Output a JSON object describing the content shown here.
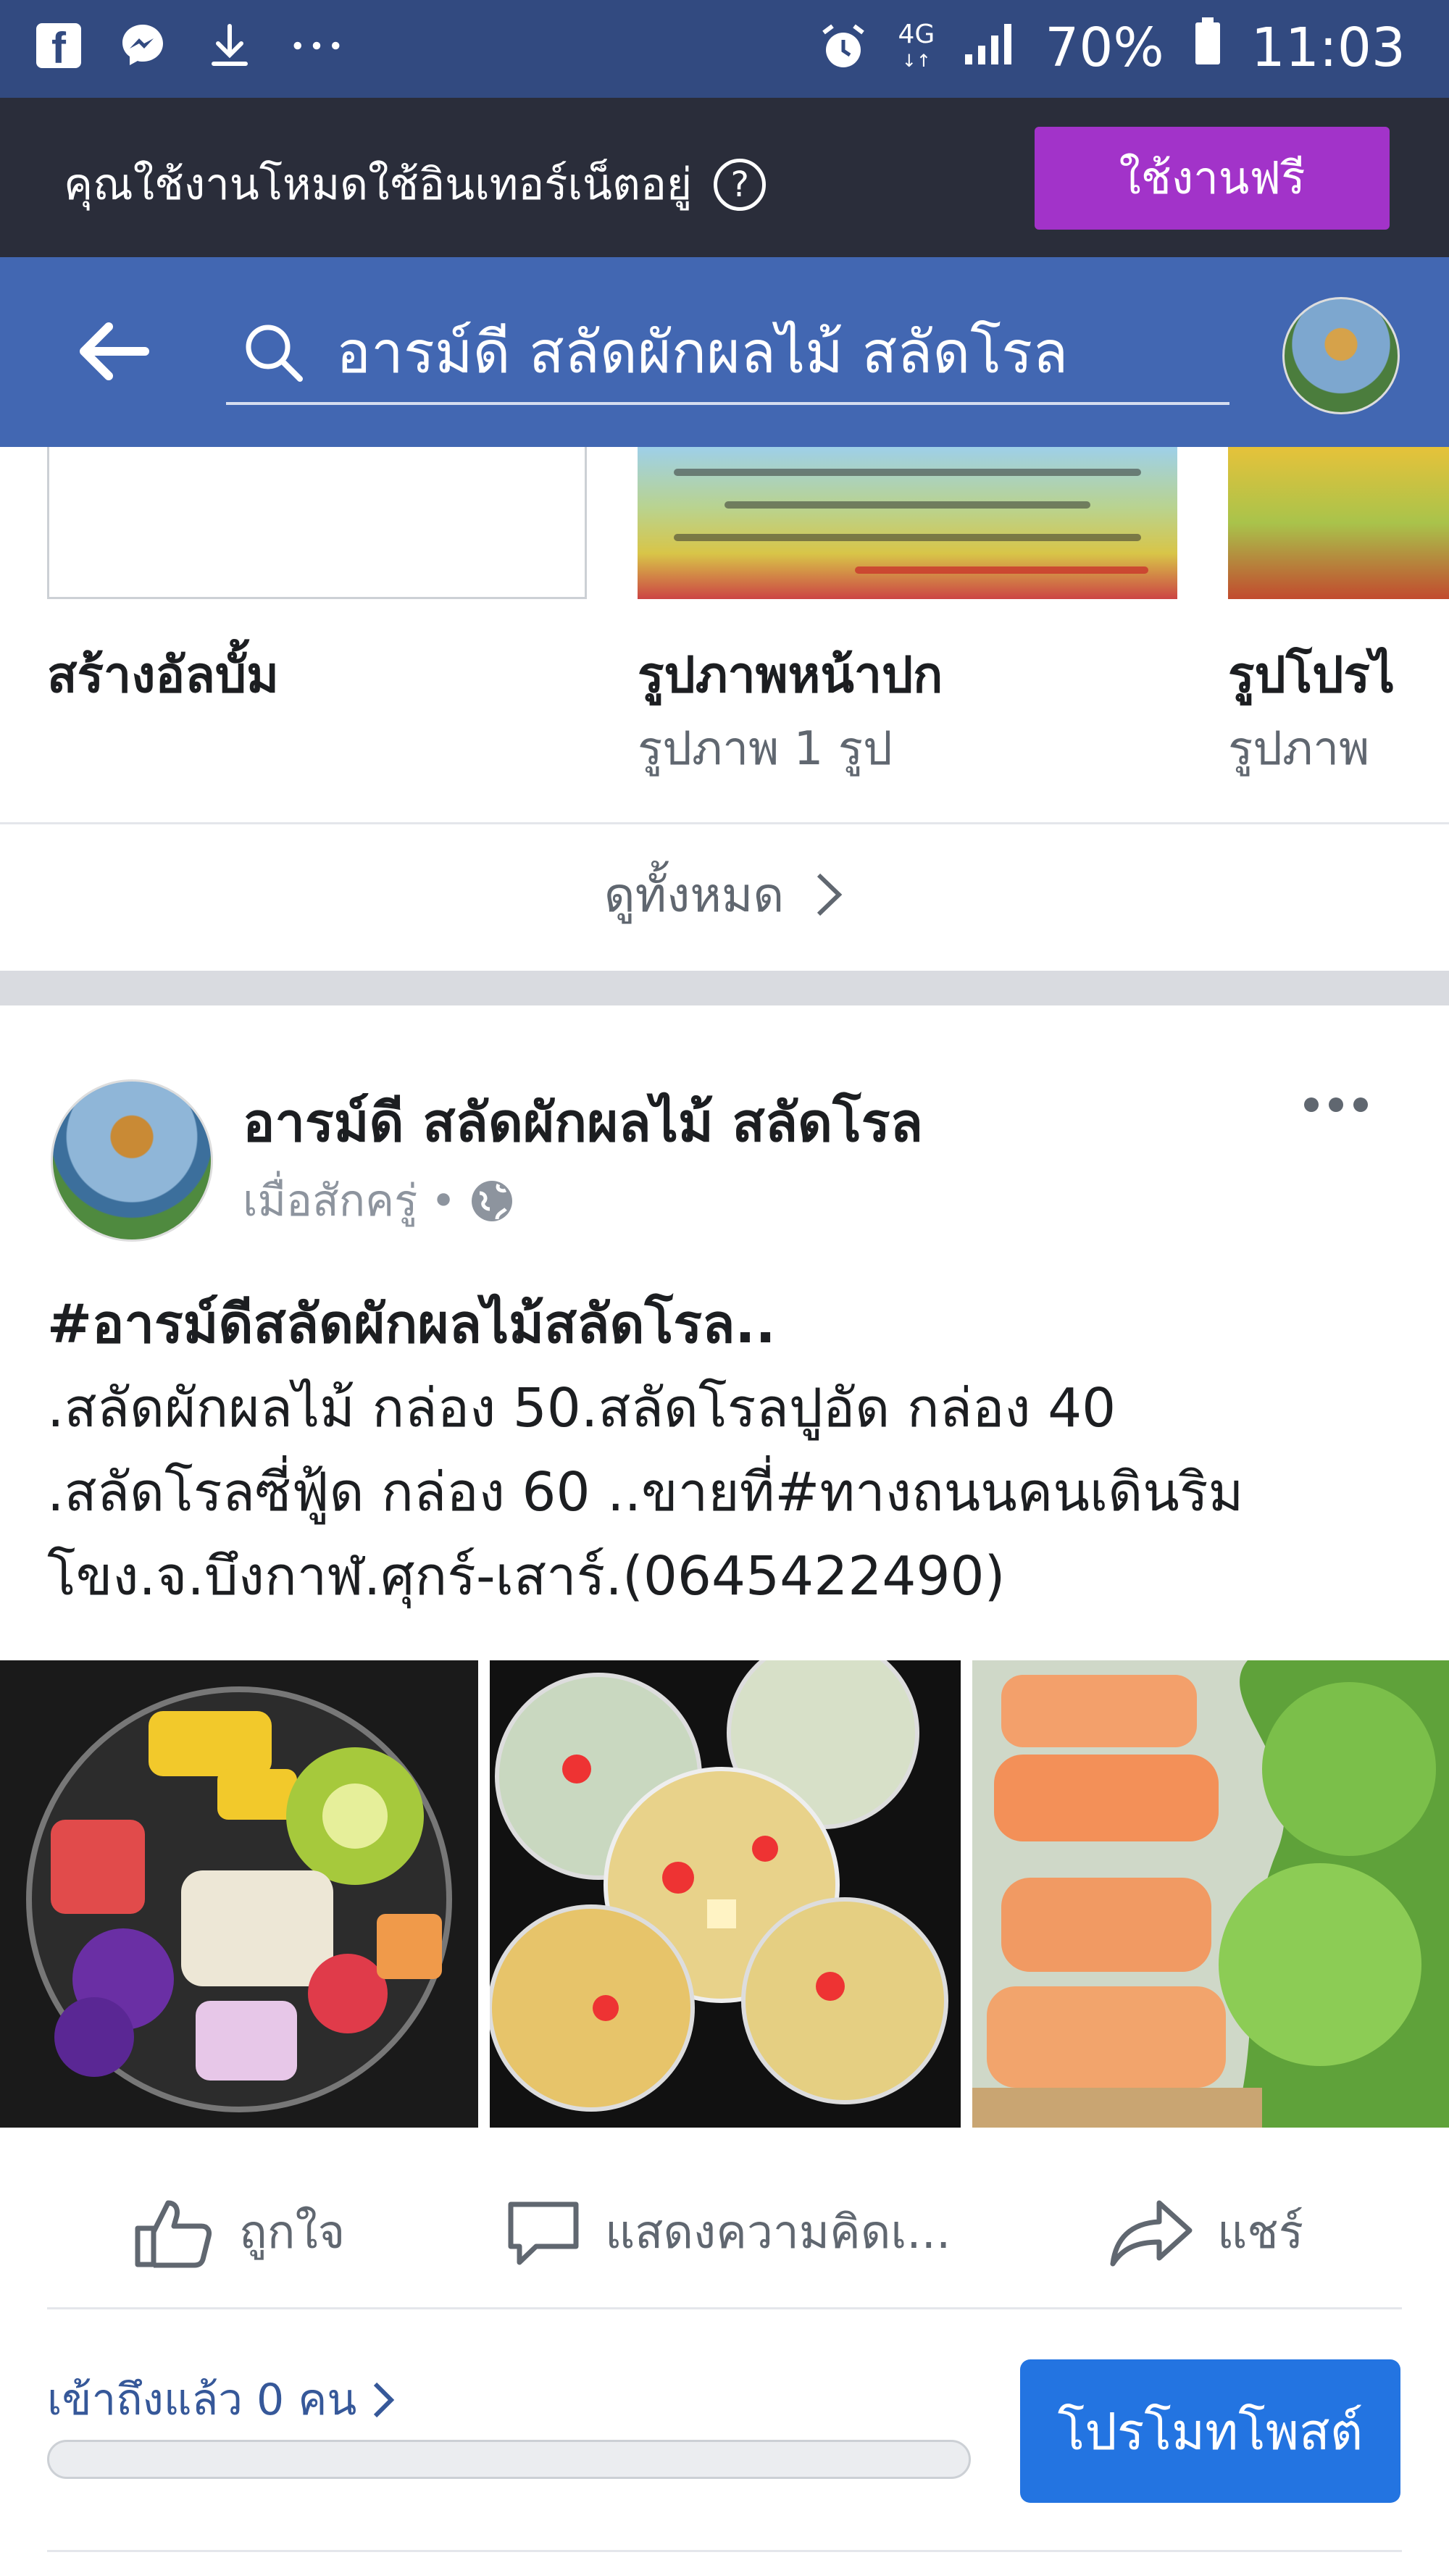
{
  "status_bar": {
    "signal_label": "4G",
    "battery": "70%",
    "time": "11:03"
  },
  "free_mode_bar": {
    "message": "คุณใช้งานโหมดใช้อินเทอร์เน็ตอยู่",
    "button": "ใช้งานฟรี"
  },
  "search": {
    "query": "อารม์ดี สลัดผักผลไม้ สลัดโรล"
  },
  "albums": {
    "items": [
      {
        "title": "สร้างอัลบั้ม",
        "subtitle": ""
      },
      {
        "title": "รูปภาพหน้าปก",
        "subtitle": "รูปภาพ 1 รูป"
      },
      {
        "title": "รูปโปรไ",
        "subtitle": "รูปภาพ"
      }
    ],
    "see_all": "ดูทั้งหมด"
  },
  "post": {
    "page_name": "อารม์ดี สลัดผักผลไม้ สลัดโรล",
    "time": "เมื่อสักครู่",
    "separator": "•",
    "lines": [
      "#อารม์ดีสลัดผักผลไม้สลัดโรล..",
      ".สลัดผักผลไม้ กล่อง 50.สลัดโรลปูอัด กล่อง 40",
      ".สลัดโรลซี่ฟู้ด กล่อง 60 ..ขายที่#ทางถนนคนเดินริม",
      "โขง.จ.บึงกาฬ.ศุกร์-เสาร์.(0645422490)"
    ],
    "actions": {
      "like": "ถูกใจ",
      "comment": "แสดงความคิดเ...",
      "share": "แชร์"
    },
    "reach": "เข้าถึงแล้ว 0 คน",
    "reach_fraction": 0,
    "promote_button": "โปรโมทโพสต์"
  },
  "colors": {
    "status_bar": "#324a80",
    "header": "#4267b2",
    "free_button": "#a233c9",
    "promote_button": "#2374e1"
  }
}
